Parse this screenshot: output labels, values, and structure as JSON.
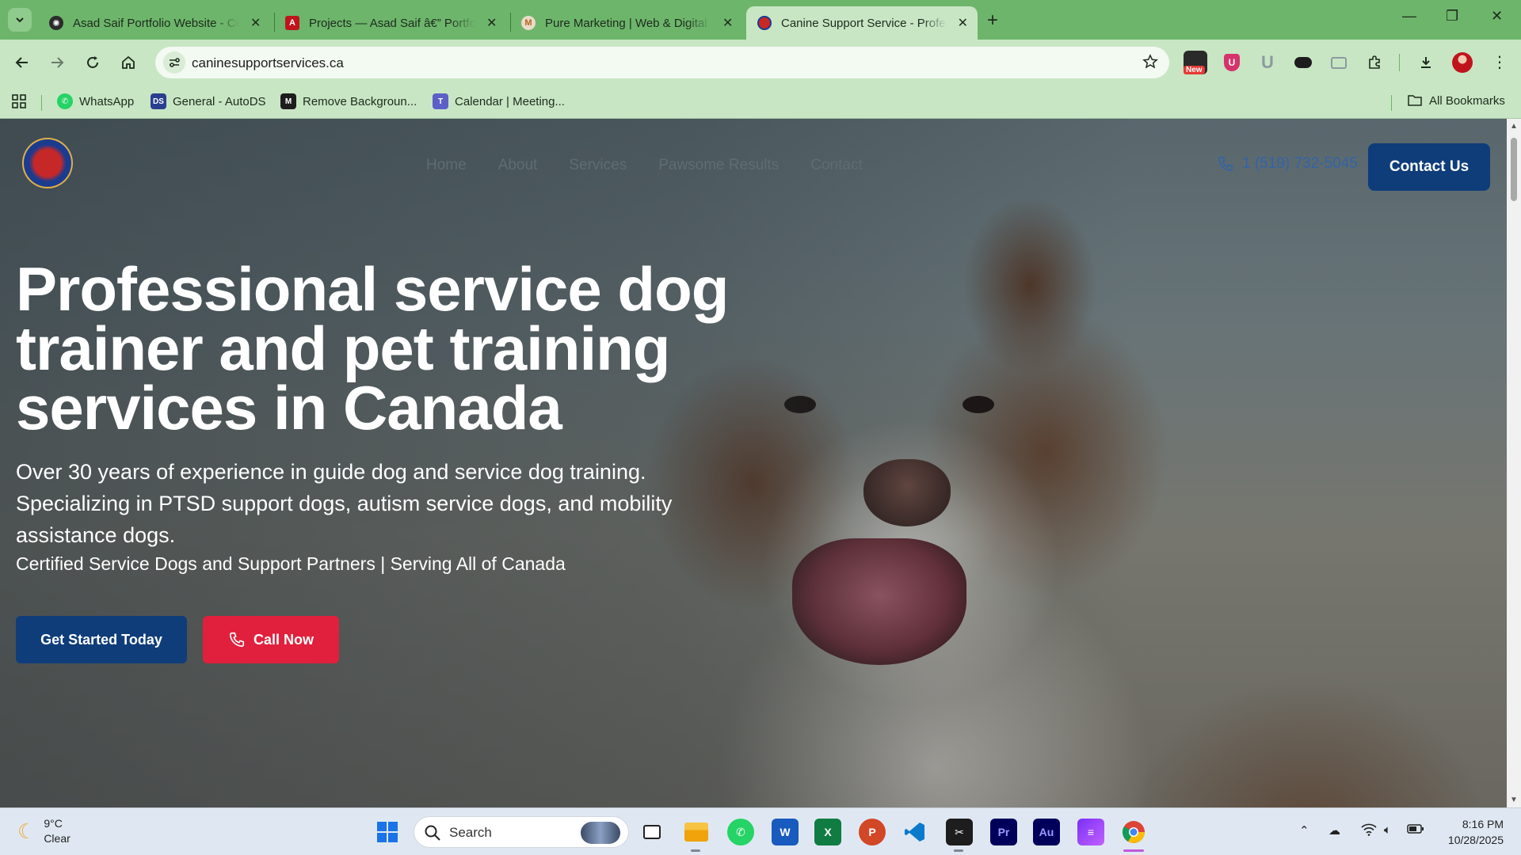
{
  "browser": {
    "tabs": [
      {
        "title": "Asad Saif Portfolio Website - Co",
        "favicon": "openai-icon"
      },
      {
        "title": "Projects — Asad Saif â€” Portfo",
        "favicon": "a-logo-icon"
      },
      {
        "title": "Pure Marketing | Web & Digital",
        "favicon": "pm-icon"
      },
      {
        "title": "Canine Support Service - Profes",
        "favicon": "canine-logo-icon",
        "active": true
      }
    ],
    "url": "caninesupportservices.ca",
    "bookmarks": [
      {
        "label": "WhatsApp"
      },
      {
        "label": "General - AutoDS"
      },
      {
        "label": "Remove Backgroun..."
      },
      {
        "label": "Calendar | Meeting..."
      }
    ],
    "all_bookmarks": "All Bookmarks",
    "new_badge": "New",
    "accent": "#6db56b"
  },
  "site": {
    "nav": [
      "Home",
      "About",
      "Services",
      "Pawsome Results",
      "Contact"
    ],
    "phone": "1 (519) 732-5045",
    "contact_button": "Contact Us",
    "hero_title": "Professional service dog trainer and pet training services in Canada",
    "hero_subtitle": "Over 30 years of experience in guide dog and service dog training. Specializing in PTSD support dogs, autism service dogs, and mobility assistance dogs.",
    "hero_certified": "Certified Service Dogs and Support Partners | Serving All of Canada",
    "cta_primary": "Get Started Today",
    "cta_call": "Call Now",
    "colors": {
      "primary": "#0f3d7a",
      "call": "#e0203d",
      "phone": "#3363a8"
    }
  },
  "taskbar": {
    "weather_temp": "9°C",
    "weather_desc": "Clear",
    "search_placeholder": "Search",
    "time": "8:16 PM",
    "date": "10/28/2025"
  }
}
